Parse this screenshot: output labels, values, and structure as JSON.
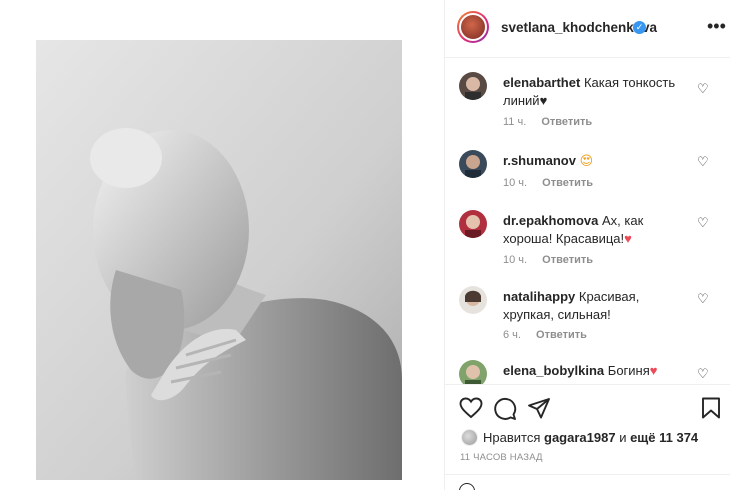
{
  "post": {
    "author": "svetlana_khodchenkova",
    "verified": true,
    "likes_prefix": "Нравится",
    "likes_user": "gagara1987",
    "likes_and": "и",
    "likes_rest": "ещё 11 374",
    "time_ago": "11 ЧАСОВ НАЗАД"
  },
  "comments": [
    {
      "user": "elenabarthet",
      "text": "Какая тонкость линий",
      "emoji": "♥",
      "emoji_color": "#262626",
      "time": "11 ч.",
      "reply": "Ответить"
    },
    {
      "user": "r.shumanov",
      "text": "",
      "emoji": "😍",
      "emoji_color": "#f0a020",
      "time": "10 ч.",
      "reply": "Ответить"
    },
    {
      "user": "dr.epakhomova",
      "text": "Ах, как хороша! Красавица!",
      "emoji": "♥",
      "emoji_color": "#ed4956",
      "time": "10 ч.",
      "reply": "Ответить"
    },
    {
      "user": "natalihappy",
      "text": "Красивая, хрупкая, сильная!",
      "emoji": "",
      "emoji_color": "",
      "time": "6 ч.",
      "reply": "Ответить"
    },
    {
      "user": "elena_bobylkina",
      "text": "Богиня",
      "emoji": "♥",
      "emoji_color": "#ed4956",
      "time": "",
      "reply": ""
    }
  ],
  "icons": {
    "more": "more-options-icon",
    "like": "heart-outline-icon",
    "comment": "comment-icon",
    "share": "share-icon",
    "save": "bookmark-icon",
    "comment_like": "small-heart-icon",
    "emoji": "emoji-icon"
  },
  "colors": {
    "verified_badge": "#3897f0",
    "muted_text": "#8e8e8e",
    "heart_red": "#ed4956"
  }
}
